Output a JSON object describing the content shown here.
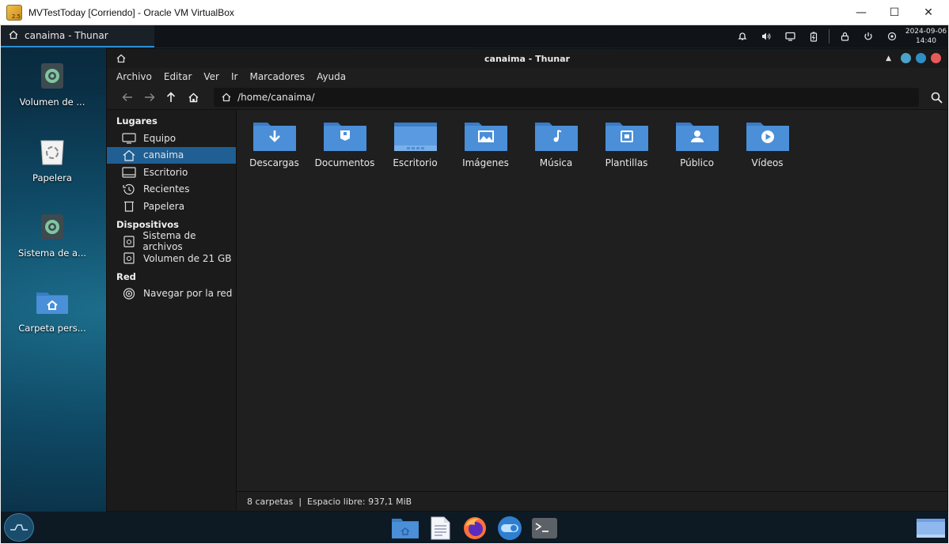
{
  "host": {
    "title": "MVTestToday [Corriendo] - Oracle VM VirtualBox",
    "logo_badge": "2.5",
    "controls": {
      "minimize": "—",
      "maximize": "☐",
      "close": "✕"
    }
  },
  "panel": {
    "task_label": "canaima - Thunar",
    "clock_date": "2024-09-06",
    "clock_time": "14:40",
    "tray_icons": [
      "bell-icon",
      "volume-icon",
      "display-icon",
      "battery-icon",
      "lock-icon",
      "power-icon",
      "settings-icon"
    ]
  },
  "desktop": {
    "icons": [
      {
        "label": "Volumen de ...",
        "icon": "drive-icon"
      },
      {
        "label": "Papelera",
        "icon": "trash-icon"
      },
      {
        "label": "Sistema de a...",
        "icon": "drive-icon"
      },
      {
        "label": "Carpeta pers...",
        "icon": "home-folder-icon"
      }
    ]
  },
  "thunar": {
    "title": "canaima - Thunar",
    "menu": [
      "Archivo",
      "Editar",
      "Ver",
      "Ir",
      "Marcadores",
      "Ayuda"
    ],
    "path": "/home/canaima/",
    "sidebar": {
      "places_header": "Lugares",
      "places": [
        {
          "label": "Equipo",
          "icon": "computer-icon",
          "selected": false
        },
        {
          "label": "canaima",
          "icon": "home-icon",
          "selected": true
        },
        {
          "label": "Escritorio",
          "icon": "desktop-icon",
          "selected": false
        },
        {
          "label": "Recientes",
          "icon": "recent-icon",
          "selected": false
        },
        {
          "label": "Papelera",
          "icon": "trash-icon",
          "selected": false
        }
      ],
      "devices_header": "Dispositivos",
      "devices": [
        {
          "label": "Sistema de archivos",
          "icon": "drive-icon"
        },
        {
          "label": "Volumen de 21 GB",
          "icon": "drive-icon"
        }
      ],
      "network_header": "Red",
      "network": [
        {
          "label": "Navegar por la red",
          "icon": "network-icon"
        }
      ]
    },
    "folders": [
      {
        "label": "Descargas",
        "emblem": "download"
      },
      {
        "label": "Documentos",
        "emblem": "document"
      },
      {
        "label": "Escritorio",
        "emblem": "desktop"
      },
      {
        "label": "Imágenes",
        "emblem": "image"
      },
      {
        "label": "Música",
        "emblem": "music"
      },
      {
        "label": "Plantillas",
        "emblem": "template"
      },
      {
        "label": "Público",
        "emblem": "user"
      },
      {
        "label": "Vídeos",
        "emblem": "video"
      }
    ],
    "status": "8 carpetas  |  Espacio libre: 937,1 MiB"
  },
  "dock": {
    "apps": [
      "file-manager-icon",
      "text-editor-icon",
      "firefox-icon",
      "settings-toggle-icon",
      "terminal-icon"
    ]
  },
  "colors": {
    "accent": "#1f5f93",
    "folder": "#4a8fd8",
    "dot_1": "#4aa3c8",
    "dot_2": "#2f8fc4",
    "dot_close": "#e85a5a"
  }
}
